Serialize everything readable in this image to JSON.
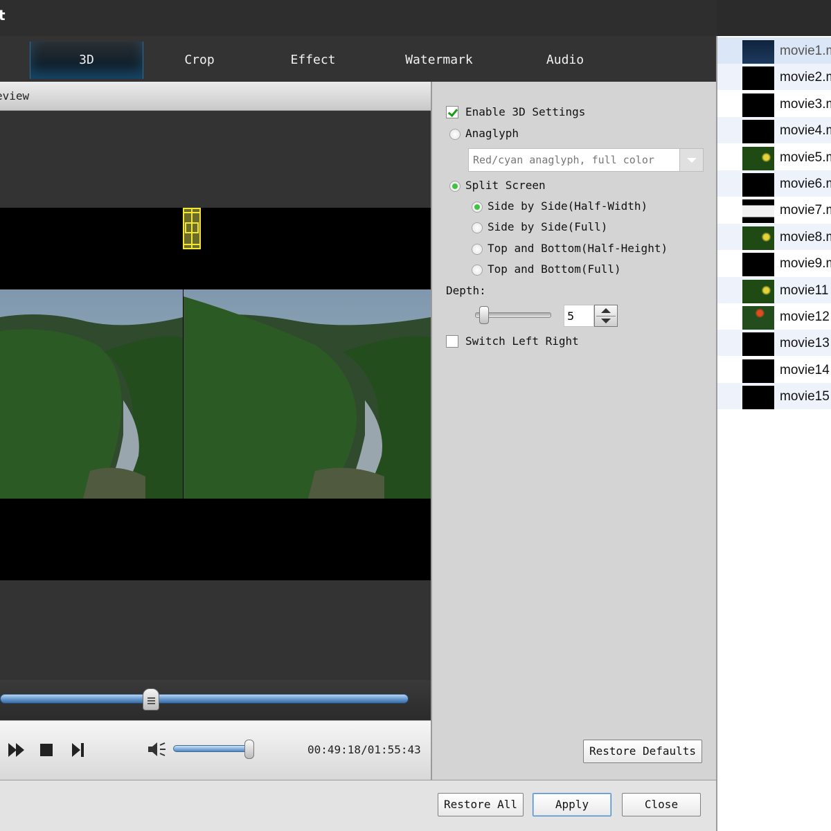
{
  "window": {
    "title": "t"
  },
  "tabs": [
    {
      "label": "3D",
      "active": true
    },
    {
      "label": "Crop"
    },
    {
      "label": "Effect"
    },
    {
      "label": "Watermark"
    },
    {
      "label": "Audio"
    }
  ],
  "preview": {
    "header": "eview",
    "seek_position": 0.37
  },
  "player": {
    "timecode": "00:49:18/01:55:43",
    "volume": 0.98,
    "icons": [
      "fast-forward-icon",
      "stop-icon",
      "next-frame-icon",
      "volume-icon"
    ]
  },
  "settings": {
    "enable_3d_label": "Enable 3D Settings",
    "enable_3d_checked": true,
    "anaglyph_label": "Anaglyph",
    "anaglyph_value": "Red/cyan anaglyph, full color",
    "split_screen_label": "Split Screen",
    "split_options": [
      "Side by Side(Half-Width)",
      "Side by Side(Full)",
      "Top and Bottom(Half-Height)",
      "Top and Bottom(Full)"
    ],
    "split_selected": 0,
    "depth_label": "Depth:",
    "depth_value": "5",
    "depth_level": 0.05,
    "switch_lr_label": "Switch Left Right",
    "restore_defaults_label": "Restore Defaults"
  },
  "bottom": {
    "restore_all": "Restore All",
    "apply": "Apply",
    "close": "Close"
  },
  "files": [
    {
      "name": "movie1.m",
      "thumb": "blue"
    },
    {
      "name": "movie2.m",
      "thumb": "black"
    },
    {
      "name": "movie3.m",
      "thumb": "black"
    },
    {
      "name": "movie4.m",
      "thumb": "black"
    },
    {
      "name": "movie5.m",
      "thumb": "green"
    },
    {
      "name": "movie6.m",
      "thumb": "black"
    },
    {
      "name": "movie7.m",
      "thumb": "white"
    },
    {
      "name": "movie8.m",
      "thumb": "green"
    },
    {
      "name": "movie9.m",
      "thumb": "black"
    },
    {
      "name": "movie11",
      "thumb": "green"
    },
    {
      "name": "movie12",
      "thumb": "red"
    },
    {
      "name": "movie13",
      "thumb": "black"
    },
    {
      "name": "movie14",
      "thumb": "black"
    },
    {
      "name": "movie15",
      "thumb": "black"
    }
  ],
  "colors": {
    "accent": "#2d6c95",
    "check": "#1a9c1a",
    "radio": "#3fc43f"
  }
}
